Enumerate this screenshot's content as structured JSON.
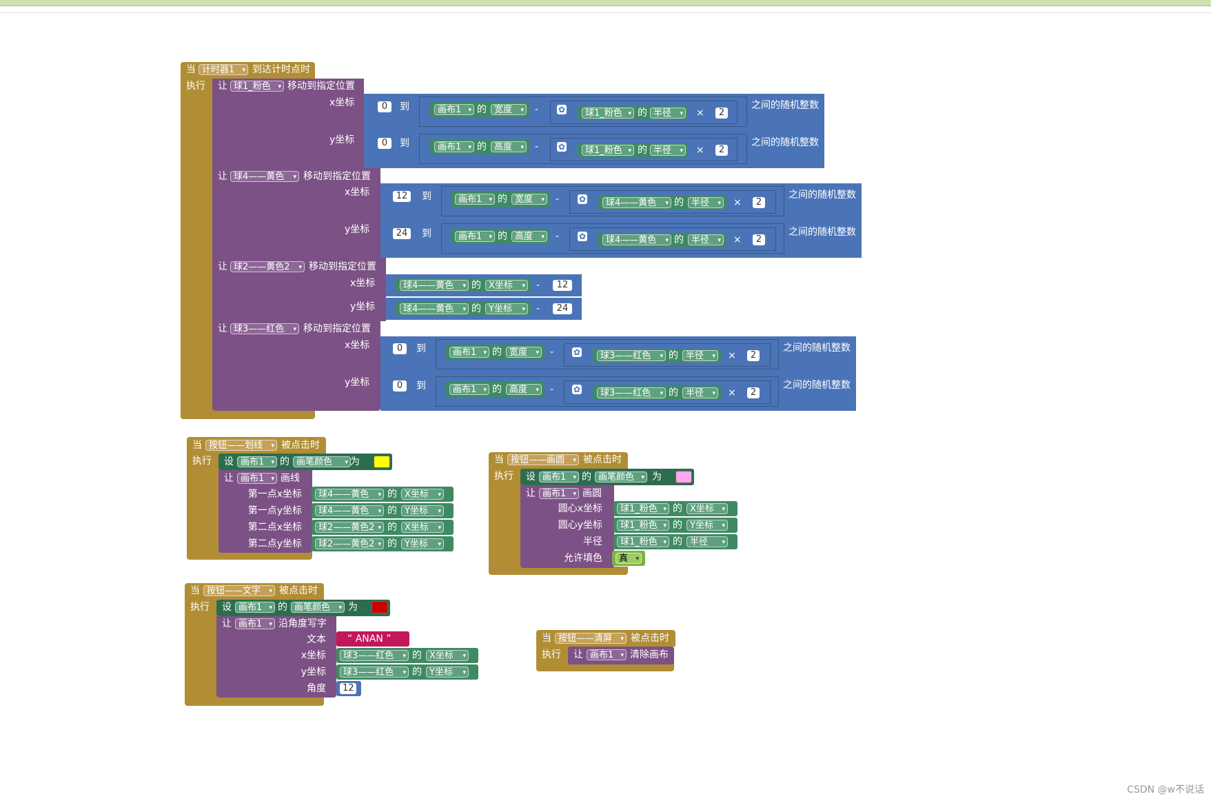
{
  "timer_event": {
    "when": "当",
    "component": "计时器1",
    "event": "到达计时点时",
    "do": "执行",
    "move1": {
      "let": "让",
      "target": "球1_粉色",
      "action": "移动到指定位置",
      "xlabel": "x坐标",
      "ylabel": "y坐标",
      "x": {
        "from": "0",
        "to": "到",
        "canvas": "画布1",
        "of": "的",
        "prop": "宽度",
        "minus": "-",
        "ball": "球1_粉色",
        "radius": "半径",
        "times": "×",
        "n": "2",
        "suffix": "之间的随机整数"
      },
      "y": {
        "from": "0",
        "to": "到",
        "canvas": "画布1",
        "of": "的",
        "prop": "高度",
        "minus": "-",
        "ball": "球1_粉色",
        "radius": "半径",
        "times": "×",
        "n": "2",
        "suffix": "之间的随机整数"
      }
    },
    "move2": {
      "let": "让",
      "target": "球4——黄色",
      "action": "移动到指定位置",
      "xlabel": "x坐标",
      "ylabel": "y坐标",
      "x": {
        "from": "12",
        "to": "到",
        "canvas": "画布1",
        "of": "的",
        "prop": "宽度",
        "minus": "-",
        "ball": "球4——黄色",
        "radius": "半径",
        "times": "×",
        "n": "2",
        "suffix": "之间的随机整数"
      },
      "y": {
        "from": "24",
        "to": "到",
        "canvas": "画布1",
        "of": "的",
        "prop": "高度",
        "minus": "-",
        "ball": "球4——黄色",
        "radius": "半径",
        "times": "×",
        "n": "2",
        "suffix": "之间的随机整数"
      }
    },
    "move3": {
      "let": "让",
      "target": "球2——黄色2",
      "action": "移动到指定位置",
      "xlabel": "x坐标",
      "ylabel": "y坐标",
      "x": {
        "ball": "球4——黄色",
        "of": "的",
        "prop": "X坐标",
        "minus": "-",
        "n": "12"
      },
      "y": {
        "ball": "球4——黄色",
        "of": "的",
        "prop": "Y坐标",
        "minus": "-",
        "n": "24"
      }
    },
    "move4": {
      "let": "让",
      "target": "球3——红色",
      "action": "移动到指定位置",
      "xlabel": "x坐标",
      "ylabel": "y坐标",
      "x": {
        "from": "0",
        "to": "到",
        "canvas": "画布1",
        "of": "的",
        "prop": "宽度",
        "minus": "-",
        "ball": "球3——红色",
        "radius": "半径",
        "times": "×",
        "n": "2",
        "suffix": "之间的随机整数"
      },
      "y": {
        "from": "0",
        "to": "到",
        "canvas": "画布1",
        "of": "的",
        "prop": "高度",
        "minus": "-",
        "ball": "球3——红色",
        "radius": "半径",
        "times": "×",
        "n": "2",
        "suffix": "之间的随机整数"
      }
    }
  },
  "line_event": {
    "when": "当",
    "component": "按钮——划线",
    "event": "被点击时",
    "do": "执行",
    "set": "设",
    "canvas": "画布1",
    "of": "的",
    "prop": "画笔颜色",
    "to": "为",
    "color": "#ffff00",
    "let": "让",
    "method": "画线",
    "rows": [
      {
        "label": "第一点x坐标",
        "ball": "球4——黄色",
        "of": "的",
        "prop": "X坐标"
      },
      {
        "label": "第一点y坐标",
        "ball": "球4——黄色",
        "of": "的",
        "prop": "Y坐标"
      },
      {
        "label": "第二点x坐标",
        "ball": "球2——黄色2",
        "of": "的",
        "prop": "X坐标"
      },
      {
        "label": "第二点y坐标",
        "ball": "球2——黄色2",
        "of": "的",
        "prop": "Y坐标"
      }
    ]
  },
  "circle_event": {
    "when": "当",
    "component": "按钮——画圆",
    "event": "被点击时",
    "do": "执行",
    "set": "设",
    "canvas": "画布1",
    "of": "的",
    "prop": "画笔颜色",
    "to": "为",
    "color": "#ffa6f0",
    "let": "让",
    "method": "画圆",
    "rows": [
      {
        "label": "圆心x坐标",
        "ball": "球1_粉色",
        "of": "的",
        "prop": "X坐标"
      },
      {
        "label": "圆心y坐标",
        "ball": "球1_粉色",
        "of": "的",
        "prop": "Y坐标"
      },
      {
        "label": "半径",
        "ball": "球1_粉色",
        "of": "的",
        "prop": "半径"
      }
    ],
    "fill_label": "允许填色",
    "fill_value": "真"
  },
  "text_event": {
    "when": "当",
    "component": "按钮——文字",
    "event": "被点击时",
    "do": "执行",
    "set": "设",
    "canvas": "画布1",
    "of": "的",
    "prop": "画笔颜色",
    "to": "为",
    "color": "#cc0000",
    "let": "让",
    "method": "沿角度写字",
    "text_label": "文本",
    "text_value": "“ ANAN ”",
    "rows": [
      {
        "label": "x坐标",
        "ball": "球3——红色",
        "of": "的",
        "prop": "X坐标"
      },
      {
        "label": "y坐标",
        "ball": "球3——红色",
        "of": "的",
        "prop": "Y坐标"
      }
    ],
    "angle_label": "角度",
    "angle_value": "12"
  },
  "clear_event": {
    "when": "当",
    "component": "按钮——清屏",
    "event": "被点击时",
    "do": "执行",
    "let": "让",
    "canvas": "画布1",
    "method": "清除画布"
  },
  "watermark": "CSDN @w不说话",
  "colors": {
    "event": "#b18e35",
    "procedure": "#7c5185",
    "math": "#4a74b7",
    "component": "#3f8a63"
  }
}
